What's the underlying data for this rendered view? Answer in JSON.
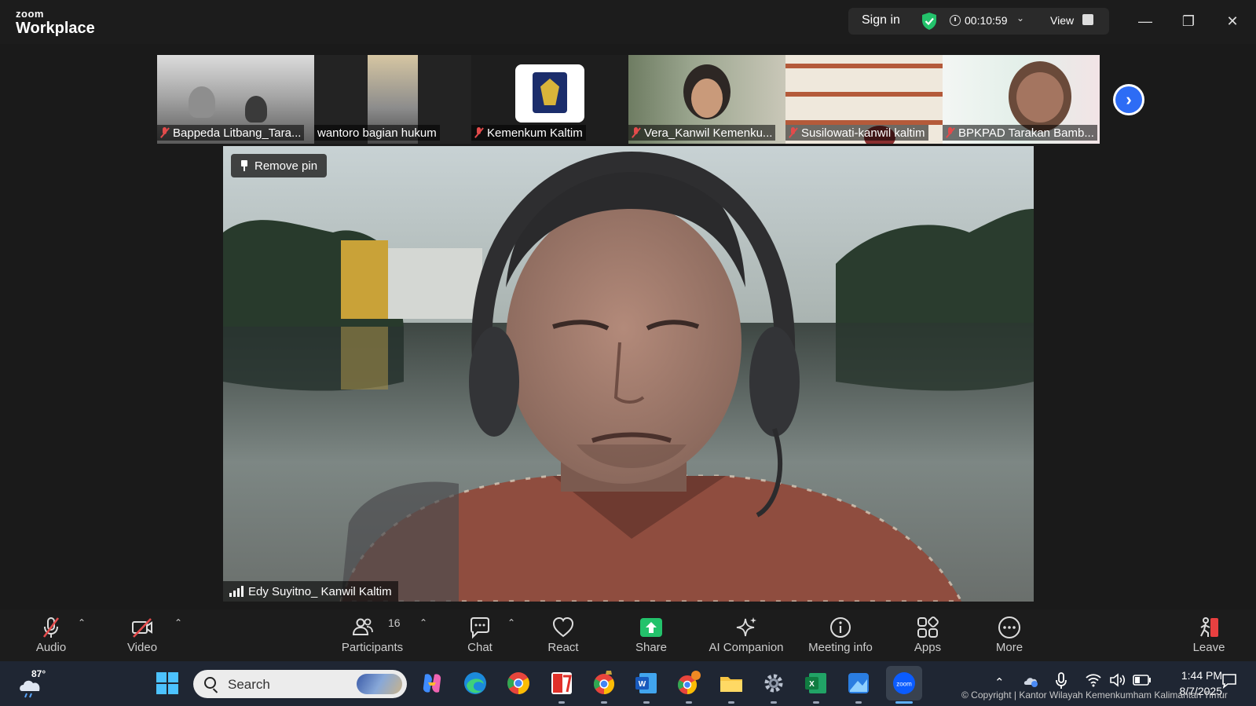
{
  "app": {
    "brand_top": "zoom",
    "brand_bottom": "Workplace"
  },
  "titlebar": {
    "sign_in": "Sign in",
    "timer": "00:10:59",
    "view": "View"
  },
  "participants_strip": [
    {
      "name": "Bappeda Litbang_Tara...",
      "muted": true
    },
    {
      "name": "wantoro bagian hukum",
      "muted": false
    },
    {
      "name": "Kemenkum Kaltim",
      "muted": true
    },
    {
      "name": "Vera_Kanwil Kemenku...",
      "muted": true
    },
    {
      "name": "Susilowati-kanwil kaltim",
      "muted": true
    },
    {
      "name": "BPKPAD Tarakan Bamb...",
      "muted": true
    }
  ],
  "main_video": {
    "pin_button": "Remove pin",
    "speaker": "Edy Suyitno_ Kanwil Kaltim"
  },
  "toolbar": {
    "audio": "Audio",
    "video": "Video",
    "participants": "Participants",
    "participants_count": "16",
    "chat": "Chat",
    "react": "React",
    "share": "Share",
    "ai_companion": "AI Companion",
    "meeting_info": "Meeting info",
    "apps": "Apps",
    "more": "More",
    "leave": "Leave"
  },
  "taskbar": {
    "temperature": "87°",
    "search_placeholder": "Search",
    "time": "1:44 PM",
    "date": "8/7/2025"
  },
  "watermark": "© Copyright | Kantor Wilayah Kemenkumham Kalimantan Timur",
  "colors": {
    "accent_blue": "#2d6cf5",
    "share_green": "#23c26b",
    "muted_red": "#e34b4b",
    "leave_red": "#e84040"
  }
}
